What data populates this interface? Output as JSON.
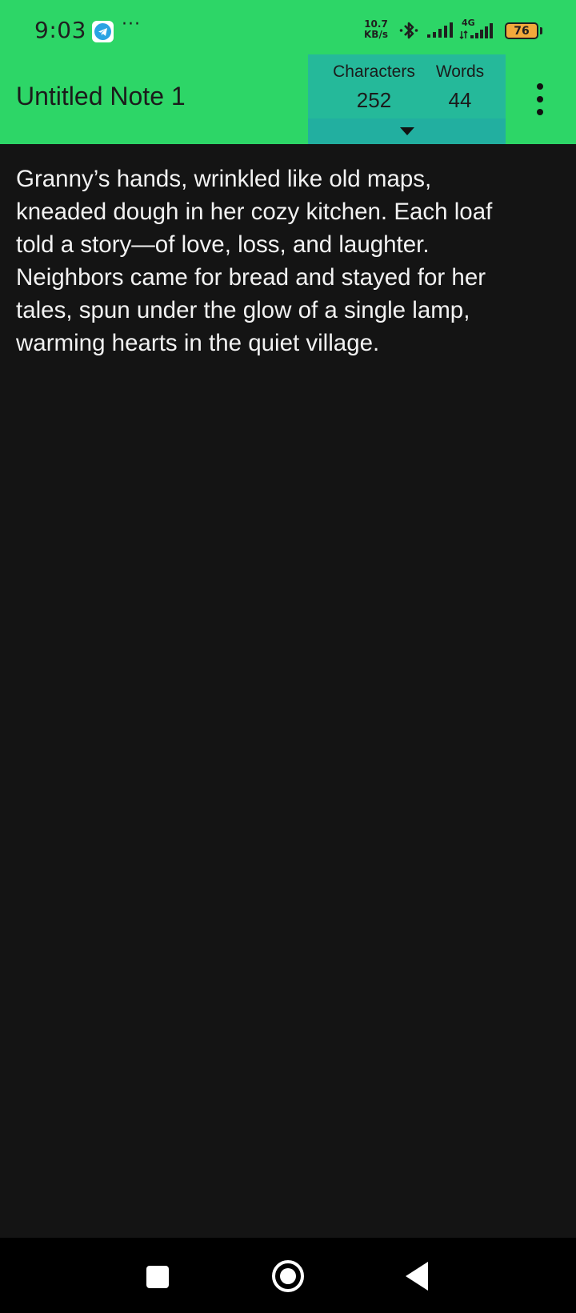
{
  "status_bar": {
    "time": "9:03",
    "more_indicator": "···",
    "speed_value": "10.7",
    "speed_unit": "KB/s",
    "network_label": "4G",
    "battery": "76",
    "icons": [
      "telegram-icon",
      "bluetooth-icon",
      "signal-icon",
      "signal-4g-icon",
      "battery-icon"
    ]
  },
  "app_bar": {
    "title": "Untitled Note 1",
    "stats": {
      "characters_label": "Characters",
      "characters_value": "252",
      "words_label": "Words",
      "words_value": "44"
    },
    "icons": [
      "caret-down-icon",
      "more-vert-icon"
    ]
  },
  "note": {
    "text": "Granny’s hands, wrinkled like old maps,\nkneaded dough in her cozy kitchen. Each loaf\ntold a story—of love, loss, and laughter.\nNeighbors came for bread and stayed for her\ntales, spun under the glow of a single lamp,\nwarming hearts in the quiet village."
  },
  "nav_bar": {
    "icons": [
      "recents-icon",
      "home-icon",
      "back-icon"
    ]
  },
  "colors": {
    "accent": "#2DD667",
    "stats_panel": "#25B99A",
    "background": "#141414",
    "text": "#f2f2f2"
  }
}
